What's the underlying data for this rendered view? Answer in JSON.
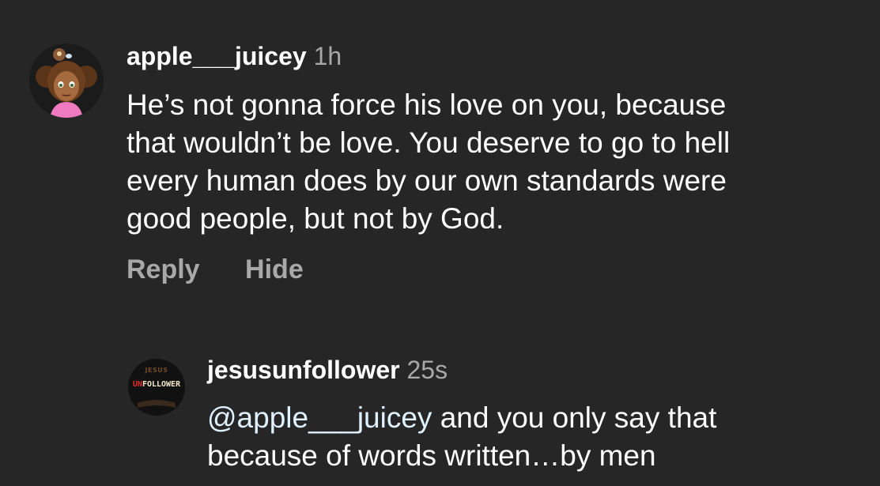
{
  "comments": [
    {
      "username": "apple___juicey",
      "time": "1h",
      "text": "He’s not gonna force his love on you, because\nthat wouldn’t be love. You deserve to go to hell\nevery human does by  our own standards were\ngood people, but not by God.",
      "actions": {
        "reply": "Reply",
        "hide": "Hide"
      }
    }
  ],
  "reply": {
    "username": "jesusunfollower",
    "time": "25s",
    "mention": "@apple___juicey",
    "text": " and you only say that\nbecause of words written…by men",
    "avatar_text": {
      "top": "JESUS",
      "prefix": "UN",
      "suffix": "FOLLOWER"
    }
  },
  "colors": {
    "background": "#262626",
    "text": "#ffffff",
    "secondary": "#a8a8a8",
    "mention": "#e0f1ff"
  }
}
